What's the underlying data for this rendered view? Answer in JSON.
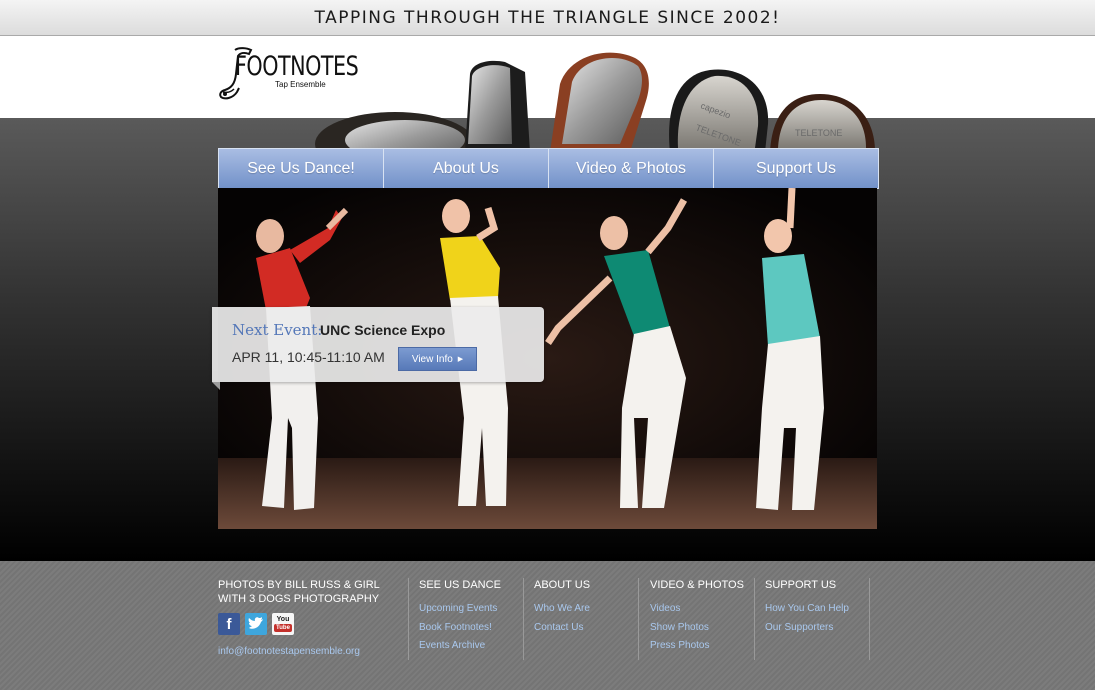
{
  "banner": {
    "tagline": "TAPPING THROUGH THE TRIANGLE SINCE 2002!"
  },
  "logo": {
    "name": "FOOTNOTES",
    "subtitle": "Tap Ensemble"
  },
  "nav": [
    {
      "label": "See Us Dance!"
    },
    {
      "label": "About Us"
    },
    {
      "label": "Video & Photos"
    },
    {
      "label": "Support Us"
    }
  ],
  "event": {
    "label": "Next Event:",
    "title": "UNC Science Expo",
    "time": "APR 11, 10:45-11:10 AM",
    "button": "View Info"
  },
  "footer": {
    "credit": "PHOTOS BY BILL RUSS & GIRL WITH 3 DOGS PHOTOGRAPHY",
    "email": "info@footnotestapensemble.org",
    "social": [
      {
        "icon": "facebook-icon",
        "glyph": "f",
        "color": "#3b5998"
      },
      {
        "icon": "twitter-icon",
        "glyph": "t",
        "color": "#3ea6dd"
      },
      {
        "icon": "youtube-icon",
        "glyph": "You",
        "color": "#c4302b"
      }
    ],
    "columns": [
      {
        "title": "SEE US DANCE",
        "links": [
          "Upcoming Events",
          "Book Footnotes!",
          "Events Archive"
        ]
      },
      {
        "title": "ABOUT US",
        "links": [
          "Who We Are",
          "Contact Us"
        ]
      },
      {
        "title": "VIDEO & PHOTOS",
        "links": [
          "Videos",
          "Show Photos",
          "Press Photos"
        ]
      },
      {
        "title": "SUPPORT US",
        "links": [
          "How You Can Help",
          "Our Supporters"
        ]
      }
    ]
  },
  "colors": {
    "nav": "#7e9bd0",
    "link": "#a9c8ee",
    "accent": "#5477b8"
  }
}
